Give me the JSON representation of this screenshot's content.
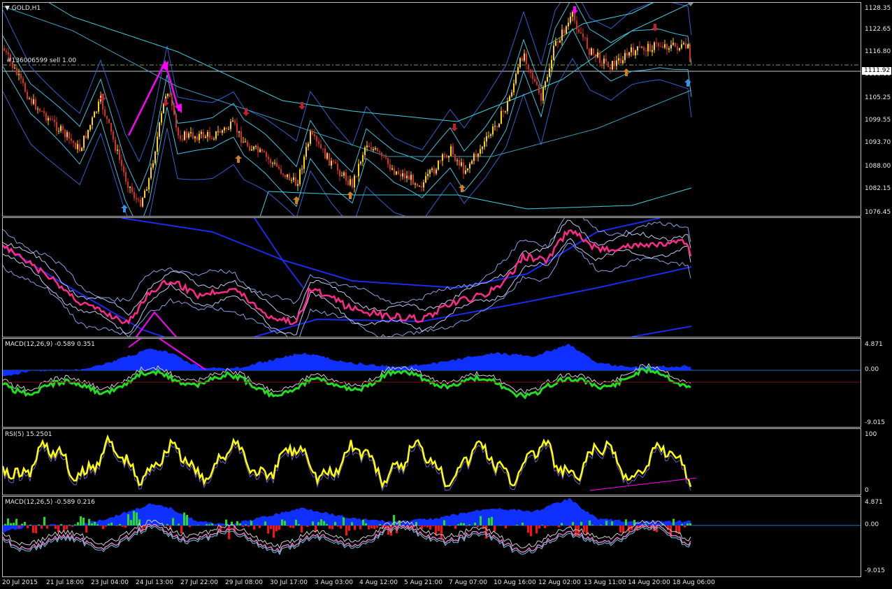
{
  "window": {
    "symbol_label": "GOLD,H1"
  },
  "order_line": {
    "label": "#136006599 sell 1.00"
  },
  "current_price": "1111.92",
  "price_scale": [
    "1128.35",
    "1122.65",
    "1116.80",
    "1111.10",
    "1105.25",
    "1099.55",
    "1093.70",
    "1088.00",
    "1082.15",
    "1076.45"
  ],
  "macd1": {
    "label": "MACD(12,26,9) -0.589 0.351",
    "scale": [
      "4.871",
      "0.00",
      "-9.015"
    ]
  },
  "rsi": {
    "label": "RSI(5) 15.2501",
    "scale": [
      "100",
      "0"
    ]
  },
  "macd2": {
    "label": "MACD(12,26,5) -0.589 0.216",
    "scale": [
      "4.871",
      "0.00",
      "-9.015"
    ]
  },
  "time_axis": [
    "20 Jul 2015",
    "21 Jul 18:00",
    "23 Jul 04:00",
    "24 Jul 13:00",
    "27 Jul 22:00",
    "29 Jul 08:00",
    "30 Jul 17:00",
    "3 Aug 03:00",
    "4 Aug 12:00",
    "5 Aug 21:00",
    "7 Aug 07:00",
    "10 Aug 16:00",
    "12 Aug 02:00",
    "13 Aug 11:00",
    "14 Aug 20:00",
    "18 Aug 06:00"
  ],
  "colors": {
    "bull": "#ffd400",
    "bear": "#d03020",
    "rsi": "#ffff00",
    "macd_line": "#22dd22",
    "hist_pos": "#1030ff",
    "osc_pink": "#ff2a8a",
    "arrow_magenta": "#ff00ff"
  }
}
